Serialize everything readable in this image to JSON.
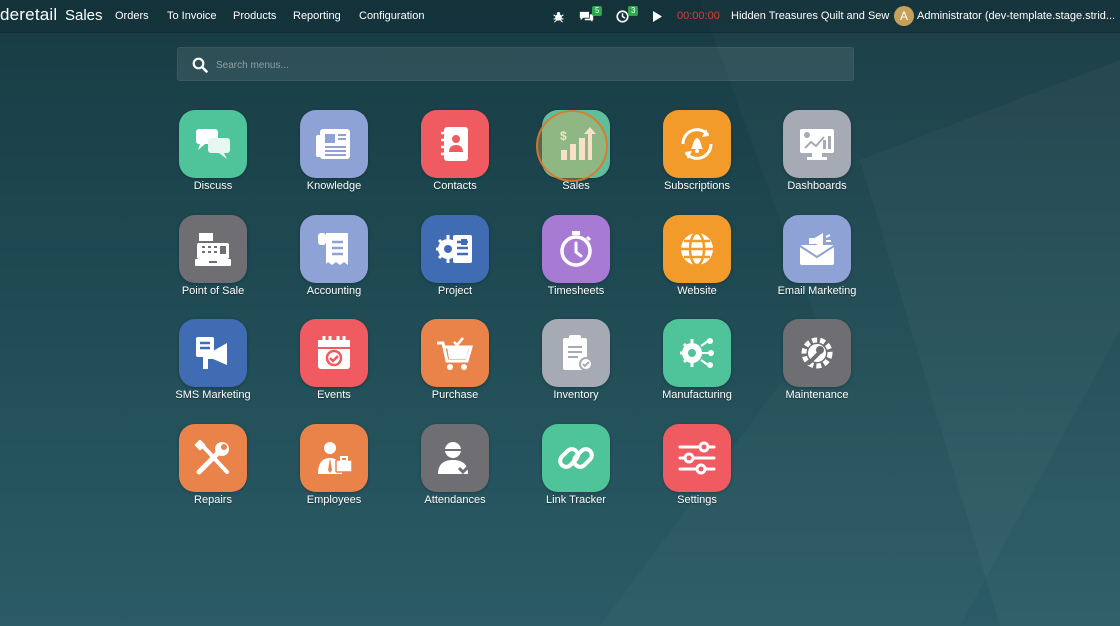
{
  "navbar": {
    "brand": "deretail",
    "app_name": "Sales",
    "menus": [
      "Orders",
      "To Invoice",
      "Products",
      "Reporting",
      "Configuration"
    ],
    "messages_count": "5",
    "activities_count": "3",
    "timer": "00:00:00",
    "company": "Hidden Treasures Quilt and Sew",
    "avatar_letter": "A",
    "user": "Administrator (dev-template.stage.strid..."
  },
  "search": {
    "placeholder": "Search menus..."
  },
  "apps": [
    {
      "label": "Discuss",
      "color": "#4fc49b",
      "icon": "chat-bubbles-icon"
    },
    {
      "label": "Knowledge",
      "color": "#8fa2d6",
      "icon": "newspaper-icon"
    },
    {
      "label": "Contacts",
      "color": "#f05a61",
      "icon": "address-book-icon"
    },
    {
      "label": "Sales",
      "color": "#5fbf9a",
      "icon": "bar-chart-dollar-icon"
    },
    {
      "label": "Subscriptions",
      "color": "#f29b2b",
      "icon": "recurring-bell-icon"
    },
    {
      "label": "Dashboards",
      "color": "#a5aab5",
      "icon": "monitor-chart-icon"
    },
    {
      "label": "Point of Sale",
      "color": "#6f6f73",
      "icon": "cash-register-icon"
    },
    {
      "label": "Accounting",
      "color": "#8fa2d6",
      "icon": "receipt-icon"
    },
    {
      "label": "Project",
      "color": "#3f6cb2",
      "icon": "gear-document-icon"
    },
    {
      "label": "Timesheets",
      "color": "#a77bd4",
      "icon": "stopwatch-icon"
    },
    {
      "label": "Website",
      "color": "#f29b2b",
      "icon": "globe-icon"
    },
    {
      "label": "Email Marketing",
      "color": "#8fa2d6",
      "icon": "envelope-megaphone-icon"
    },
    {
      "label": "SMS Marketing",
      "color": "#3f6cb2",
      "icon": "sms-megaphone-icon"
    },
    {
      "label": "Events",
      "color": "#f05a61",
      "icon": "calendar-check-icon"
    },
    {
      "label": "Purchase",
      "color": "#e9834a",
      "icon": "shopping-cart-icon"
    },
    {
      "label": "Inventory",
      "color": "#a5aab5",
      "icon": "clipboard-check-icon"
    },
    {
      "label": "Manufacturing",
      "color": "#4fc49b",
      "icon": "gear-network-icon"
    },
    {
      "label": "Maintenance",
      "color": "#6f6f73",
      "icon": "wrench-gear-icon"
    },
    {
      "label": "Repairs",
      "color": "#e9834a",
      "icon": "tools-icon"
    },
    {
      "label": "Employees",
      "color": "#e9834a",
      "icon": "employee-briefcase-icon"
    },
    {
      "label": "Attendances",
      "color": "#6f6f73",
      "icon": "user-check-icon"
    },
    {
      "label": "Link Tracker",
      "color": "#4fc49b",
      "icon": "chain-link-icon"
    },
    {
      "label": "Settings",
      "color": "#f05a61",
      "icon": "sliders-icon"
    }
  ]
}
